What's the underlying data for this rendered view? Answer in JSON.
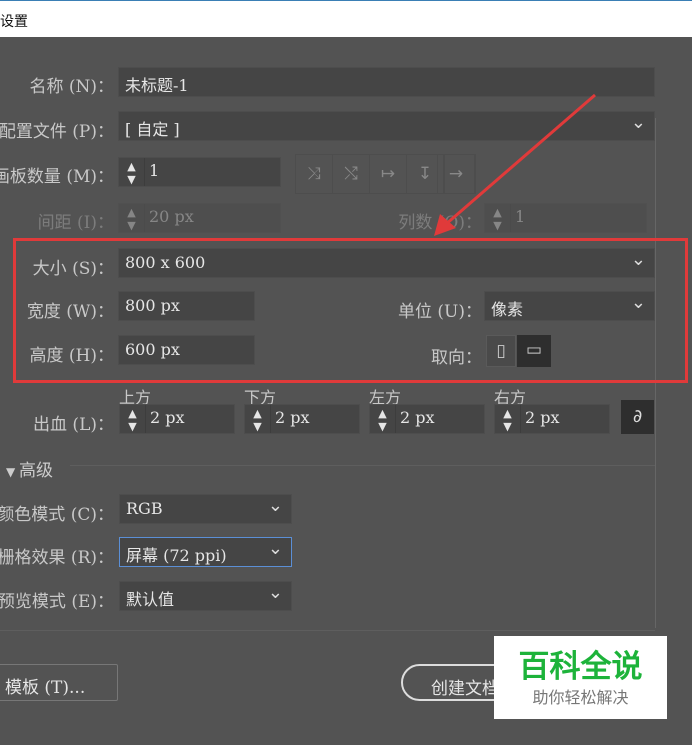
{
  "window": {
    "title": "设置"
  },
  "form": {
    "name": {
      "label": "名称 (N)：",
      "value": "未标题-1"
    },
    "profile": {
      "label": "配置文件 (P)：",
      "value": "[ 自定 ]"
    },
    "artboards": {
      "label": "画板数量 (M)：",
      "value": "1"
    },
    "spacing": {
      "label": "间距 (I)：",
      "value": "20 px"
    },
    "columns": {
      "label": "列数 (O)：",
      "value": "1"
    },
    "size": {
      "label": "大小 (S)：",
      "value": "800 x 600"
    },
    "width": {
      "label": "宽度 (W)：",
      "value": "800 px"
    },
    "height": {
      "label": "高度 (H)：",
      "value": "600 px"
    },
    "units": {
      "label": "单位 (U)：",
      "value": "像素"
    },
    "orientation": {
      "label": "取向："
    },
    "bleed": {
      "label": "出血 (L)：",
      "top_label": "上方",
      "bottom_label": "下方",
      "left_label": "左方",
      "right_label": "右方",
      "top": "2 px",
      "bottom": "2 px",
      "left": "2 px",
      "right": "2 px"
    },
    "advanced": {
      "label": "高级"
    },
    "color_mode": {
      "label": "颜色模式 (C)：",
      "value": "RGB"
    },
    "raster": {
      "label": "栅格效果 (R)：",
      "value": "屏幕 (72 ppi)"
    },
    "preview": {
      "label": "预览模式 (E)：",
      "value": "默认值"
    }
  },
  "buttons": {
    "templates": "模板 (T)...",
    "create": "创建文档"
  },
  "watermark": {
    "title": "百科全说",
    "subtitle": "助你轻松解决"
  },
  "colors": {
    "highlight": "#e03a3a",
    "watermark": "#1db33a"
  }
}
